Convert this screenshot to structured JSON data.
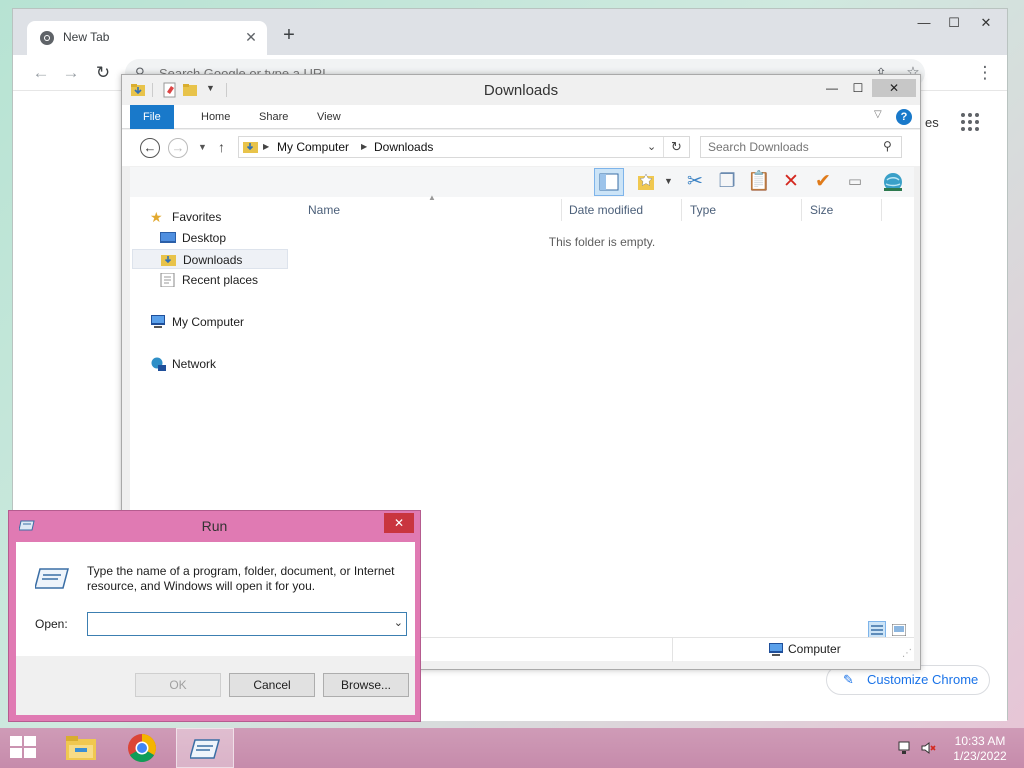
{
  "chrome": {
    "tab_title": "New Tab",
    "tab_close": "✕",
    "new_tab": "+",
    "omnibox_placeholder": "Search Google or type a URL",
    "images_link": "es",
    "customize_label": "Customize Chrome",
    "win_minimize": "—",
    "win_maximize": "☐",
    "win_close": "✕"
  },
  "explorer": {
    "title": "Downloads",
    "ribbon_tabs": [
      "File",
      "Home",
      "Share",
      "View"
    ],
    "help": "?",
    "breadcrumb": [
      "My Computer",
      "Downloads"
    ],
    "search_placeholder": "Search Downloads",
    "nav": {
      "favorites": "Favorites",
      "desktop": "Desktop",
      "downloads": "Downloads",
      "recent": "Recent places",
      "computer": "My Computer",
      "network": "Network"
    },
    "columns": [
      "Name",
      "Date modified",
      "Type",
      "Size"
    ],
    "empty_message": "This folder is empty.",
    "status_location": "Computer",
    "win_minimize": "—",
    "win_maximize": "☐",
    "win_close": "✕"
  },
  "run": {
    "title": "Run",
    "close": "✕",
    "description": "Type the name of a program, folder, document, or Internet resource, and Windows will open it for you.",
    "open_label": "Open:",
    "open_value": "",
    "ok_label": "OK",
    "cancel_label": "Cancel",
    "browse_label": "Browse..."
  },
  "taskbar": {
    "time": "10:33 AM",
    "date": "1/23/2022"
  },
  "colors": {
    "accent": "#1979ca",
    "run_frame": "#e07ab3",
    "taskbar": "#c68bab"
  }
}
